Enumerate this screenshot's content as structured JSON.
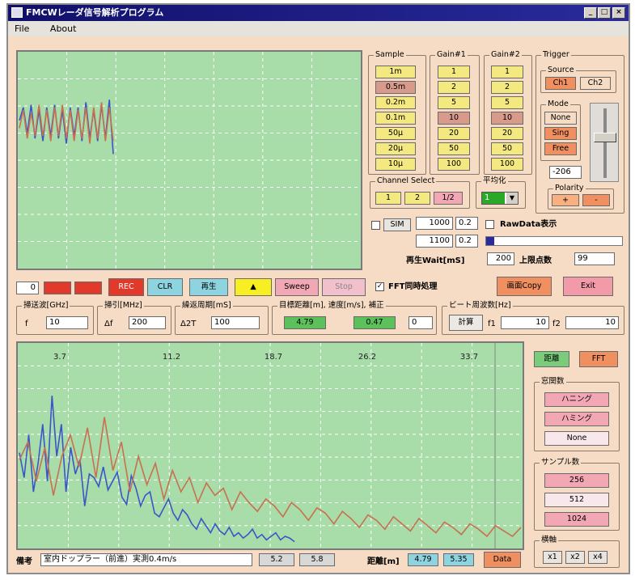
{
  "window": {
    "title": "FMCWレーダ信号解析プログラム"
  },
  "menu": {
    "file": "File",
    "about": "About"
  },
  "sample": {
    "label": "Sample",
    "options": [
      "1m",
      "0.5m",
      "0.2m",
      "0.1m",
      "50μ",
      "20μ",
      "10μ"
    ],
    "selected": 1
  },
  "gain1": {
    "label": "Gain#1",
    "options": [
      "1",
      "2",
      "5",
      "10",
      "20",
      "50",
      "100"
    ],
    "selected": 3
  },
  "gain2": {
    "label": "Gain#2",
    "options": [
      "1",
      "2",
      "5",
      "10",
      "20",
      "50",
      "100"
    ],
    "selected": 3
  },
  "trigger": {
    "label": "Trigger",
    "source": {
      "label": "Source",
      "ch1": "Ch1",
      "ch2": "Ch2"
    },
    "mode": {
      "label": "Mode",
      "none": "None",
      "single": "Sing",
      "free": "Free"
    },
    "level": "-206",
    "polarity": {
      "label": "Polarity",
      "plus": "+",
      "minus": "-"
    }
  },
  "channel_select": {
    "label": "Channel Select",
    "options": [
      "1",
      "2",
      "1/2"
    ]
  },
  "averaging": {
    "label": "平均化",
    "value": "1"
  },
  "sim": {
    "label": "SIM",
    "field1": "1000",
    "field2": "0.2",
    "field3": "1100",
    "field4": "0.2"
  },
  "raw_data_display": "RawData表示",
  "playback_wait": {
    "label": "再生Wait[mS]",
    "value": "200"
  },
  "upper_points": {
    "label": "上限点数",
    "value": "99"
  },
  "controls": {
    "counter": "0",
    "rec": "REC",
    "clr": "CLR",
    "play": "再生",
    "triangle": "▲",
    "sweep": "Sweep",
    "stop": "Stop",
    "fft_sync": "FFT同時処理",
    "screen_copy": "画面Copy",
    "exit": "Exit"
  },
  "params": {
    "freq_label": "掃送波[GHz]",
    "f_sym": "f",
    "f_value": "10",
    "sweep_label": "掃引[MHz]",
    "df_sym": "Δf",
    "df_value": "200",
    "period_label": "繰返周期[mS]",
    "dt_sym": "Δ2T",
    "dt_value": "100",
    "target_label": "目標距離[m], 速度[m/s], 補正",
    "distance": "4.79",
    "speed": "0.47",
    "correction": "0",
    "beat_label": "ビート周波数[Hz]",
    "calc": "計算",
    "f1_sym": "f1",
    "f1_value": "10",
    "f2_sym": "f2",
    "f2_value": "10"
  },
  "fft_display": {
    "distance_btn": "距離",
    "fft_btn": "FFT"
  },
  "window_fn": {
    "label": "窓関数",
    "options": [
      "ハニング",
      "ハミング",
      "None"
    ]
  },
  "sample_count": {
    "label": "サンプル数",
    "options": [
      "256",
      "512",
      "1024"
    ]
  },
  "zoom": {
    "label": "横軸",
    "options": [
      "x1",
      "x2",
      "x4"
    ]
  },
  "bottom": {
    "note_label": "備考",
    "note_value": "室内ドップラー（前進）実測0.4m/s",
    "f1": "5.2",
    "f2": "5.8",
    "distance_label": "距離[m]",
    "d1": "4.79",
    "d2": "5.35",
    "data": "Data"
  },
  "chart_data": [
    {
      "type": "line",
      "series": [
        {
          "color": "#3a56c8",
          "values": [
            0.1,
            0.6,
            -0.4,
            0.7,
            -0.6,
            0.5,
            -0.7,
            0.6,
            -0.5,
            0.7,
            -0.6,
            0.5,
            -0.8,
            0.6,
            -0.5,
            0.6,
            -0.7,
            0.8,
            -0.6,
            0.5,
            -0.7,
            0.7,
            -0.6,
            0.9,
            -1.2
          ]
        },
        {
          "color": "#c87050",
          "values": [
            -0.2,
            0.5,
            -0.6,
            0.4,
            -0.5,
            0.7,
            -0.5,
            0.5,
            -0.7,
            0.6,
            -0.5,
            0.7,
            -0.6,
            0.5,
            -0.7,
            0.5,
            -0.6,
            0.6,
            -0.8,
            0.6,
            -0.6,
            0.8,
            -0.7,
            0.6,
            -0.7
          ]
        }
      ]
    },
    {
      "type": "line",
      "x_ticks": [
        "3.7",
        "11.2",
        "18.7",
        "26.2",
        "33.7"
      ],
      "series": [
        {
          "color": "#3a56c8",
          "values": [
            0.52,
            0.38,
            0.62,
            0.3,
            0.46,
            0.68,
            0.36,
            0.84,
            0.5,
            0.68,
            0.3,
            0.55,
            0.4,
            0.48,
            0.22,
            0.4,
            0.38,
            0.33,
            0.44,
            0.31,
            0.36,
            0.41,
            0.27,
            0.23,
            0.39,
            0.32,
            0.22,
            0.28,
            0.3,
            0.18,
            0.16,
            0.21,
            0.26,
            0.18,
            0.14,
            0.2,
            0.17,
            0.12,
            0.09,
            0.15,
            0.11,
            0.07,
            0.12,
            0.08,
            0.06,
            0.1,
            0.05,
            0.07,
            0.04,
            0.06,
            0.09,
            0.04,
            0.06,
            0.03,
            0.05,
            0.07,
            0.03,
            0.05,
            0.04,
            0.02
          ]
        },
        {
          "color": "#c87050",
          "values": [
            0.48,
            0.58,
            0.36,
            0.55,
            0.28,
            0.5,
            0.62,
            0.44,
            0.66,
            0.38,
            0.72,
            0.42,
            0.58,
            0.3,
            0.5,
            0.34,
            0.46,
            0.26,
            0.42,
            0.3,
            0.38,
            0.24,
            0.35,
            0.28,
            0.32,
            0.2,
            0.3,
            0.24,
            0.19,
            0.26,
            0.22,
            0.16,
            0.24,
            0.2,
            0.14,
            0.21,
            0.18,
            0.12,
            0.19,
            0.15,
            0.1,
            0.17,
            0.14,
            0.09,
            0.16,
            0.12,
            0.08,
            0.15,
            0.11,
            0.07,
            0.13,
            0.1,
            0.06,
            0.12,
            0.09,
            0.05,
            0.11,
            0.08,
            0.05,
            0.1
          ]
        }
      ]
    }
  ]
}
